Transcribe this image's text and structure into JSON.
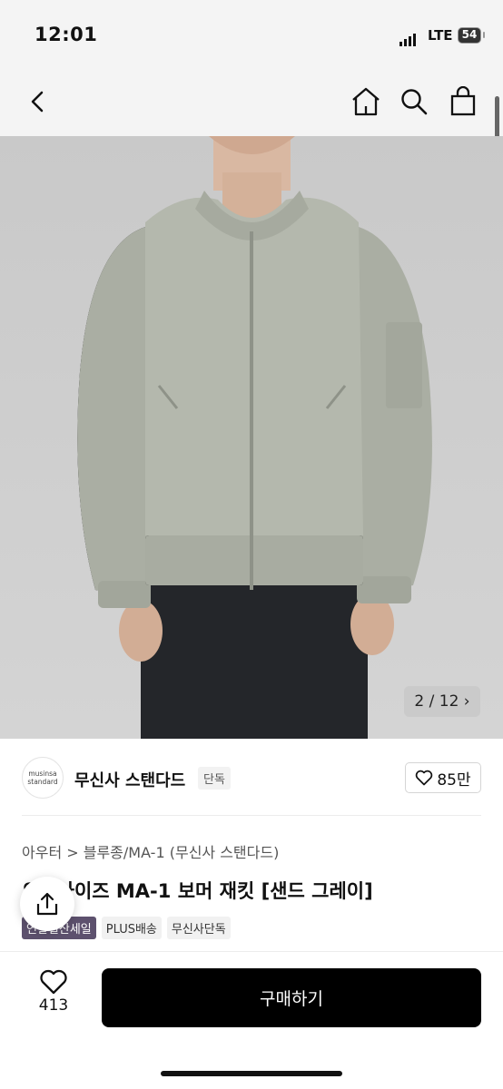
{
  "status": {
    "time": "12:01",
    "network": "LTE",
    "battery": "54"
  },
  "nav": {
    "back_icon": "chevron-left-icon",
    "home_icon": "home-icon",
    "search_icon": "search-icon",
    "bag_icon": "shopping-bag-icon"
  },
  "gallery": {
    "counter": "2 / 12 ›",
    "current": 2,
    "total": 12
  },
  "brand": {
    "logo_line1": "musinsa",
    "logo_line2": "standard",
    "name": "무신사 스탠다드",
    "badge": "단독",
    "likes": "85만"
  },
  "product": {
    "breadcrumb": "아우터 > 블루종/MA-1 (무신사 스탠다드)",
    "title": "오버사이즈 MA-1 보머 재킷 [샌드 그레이]",
    "tags": [
      "연말결산세일",
      "PLUS배송",
      "무신사단독"
    ]
  },
  "bottom": {
    "wish_count": "413",
    "buy_label": "구매하기"
  },
  "colors": {
    "jacket": "#b4b8ad",
    "buy_button": "#000000",
    "sale_tag": "#5d516e"
  }
}
